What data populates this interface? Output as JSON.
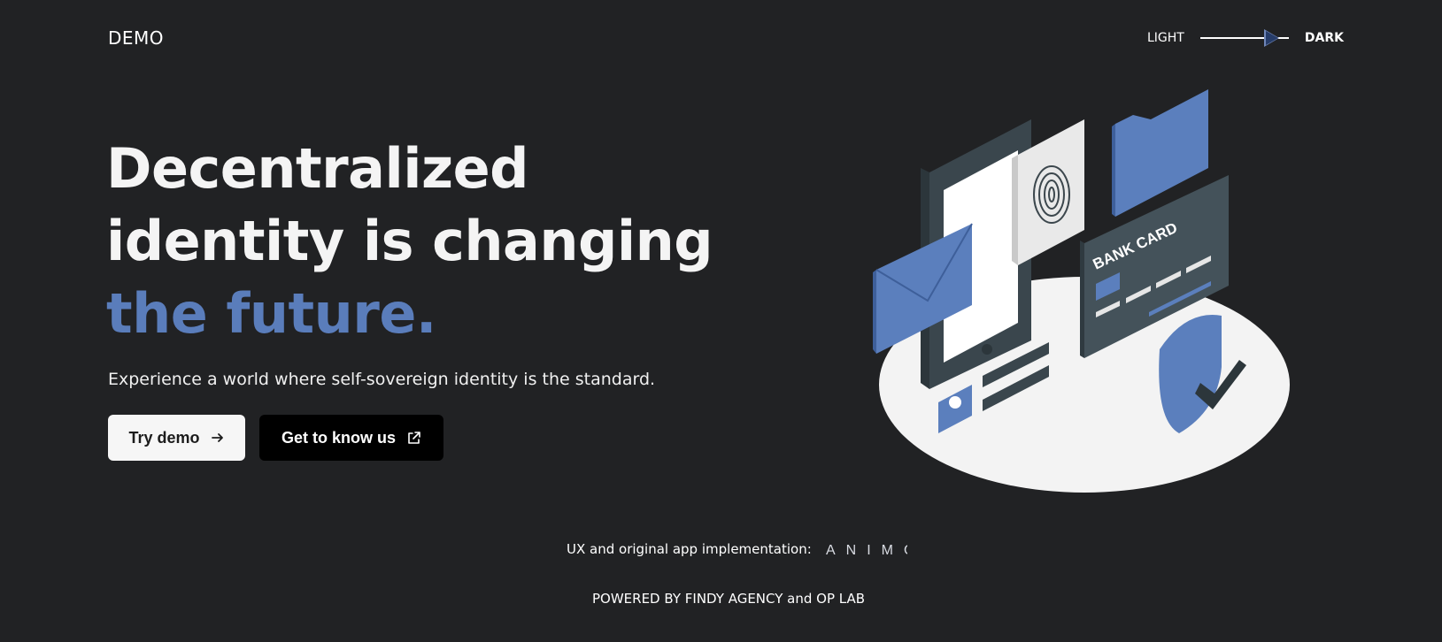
{
  "header": {
    "logo": "DEMO",
    "theme_toggle": {
      "light_label": "LIGHT",
      "dark_label": "DARK",
      "selected": "DARK"
    }
  },
  "hero": {
    "title_line1": "Decentralized",
    "title_line2": "identity is changing",
    "title_line3": "the future.",
    "subtitle": "Experience a world where self-sovereign identity is the standard.",
    "try_demo_label": "Try demo",
    "know_us_label": "Get to know us"
  },
  "illustration": {
    "bank_card_text": "BANK CARD"
  },
  "footer": {
    "credits_label": "UX and original app implementation:",
    "animo_logo_text": "ANIMO",
    "powered_by": "POWERED BY  FINDY AGENCY and OP LAB"
  },
  "colors": {
    "background": "#212224",
    "accent": "#5a7dbb",
    "illustration_blue": "#5b7fbd",
    "illustration_slate": "#44525a"
  }
}
